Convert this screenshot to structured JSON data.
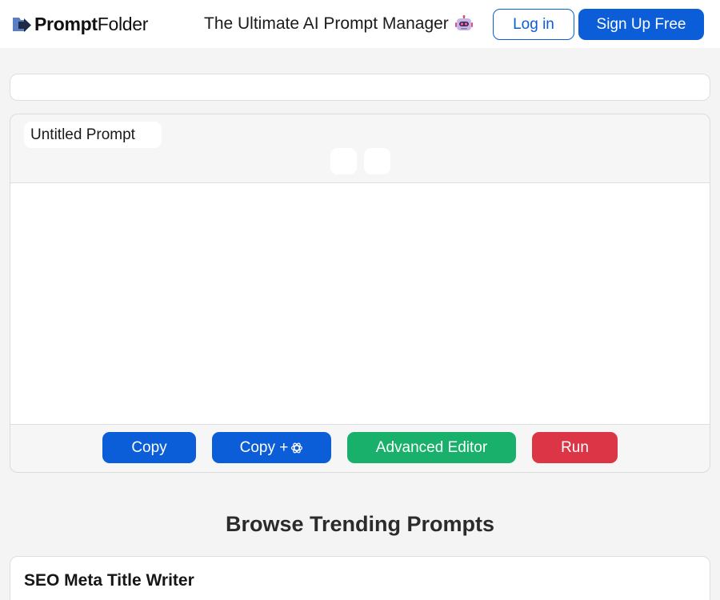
{
  "header": {
    "logo_bold": "Prompt",
    "logo_regular": "Folder",
    "tagline": "The Ultimate AI Prompt Manager",
    "login_label": "Log in",
    "signup_label": "Sign Up Free"
  },
  "search": {
    "value": ""
  },
  "editor": {
    "title_value": "Untitled Prompt",
    "prompt_value": "",
    "copy_label": "Copy",
    "copy_gpt_label": "Copy +",
    "advanced_label": "Advanced Editor",
    "run_label": "Run"
  },
  "trending": {
    "heading": "Browse Trending Prompts",
    "items": [
      {
        "title": "SEO Meta Title Writer"
      }
    ]
  },
  "colors": {
    "primary": "#0b5ed7",
    "success": "#19b06b",
    "danger": "#dc3545",
    "background": "#f4f4f4"
  },
  "icons": {
    "logo": "folder-arrow-icon",
    "tagline": "robot-icon",
    "copy_gpt": "openai-icon"
  }
}
